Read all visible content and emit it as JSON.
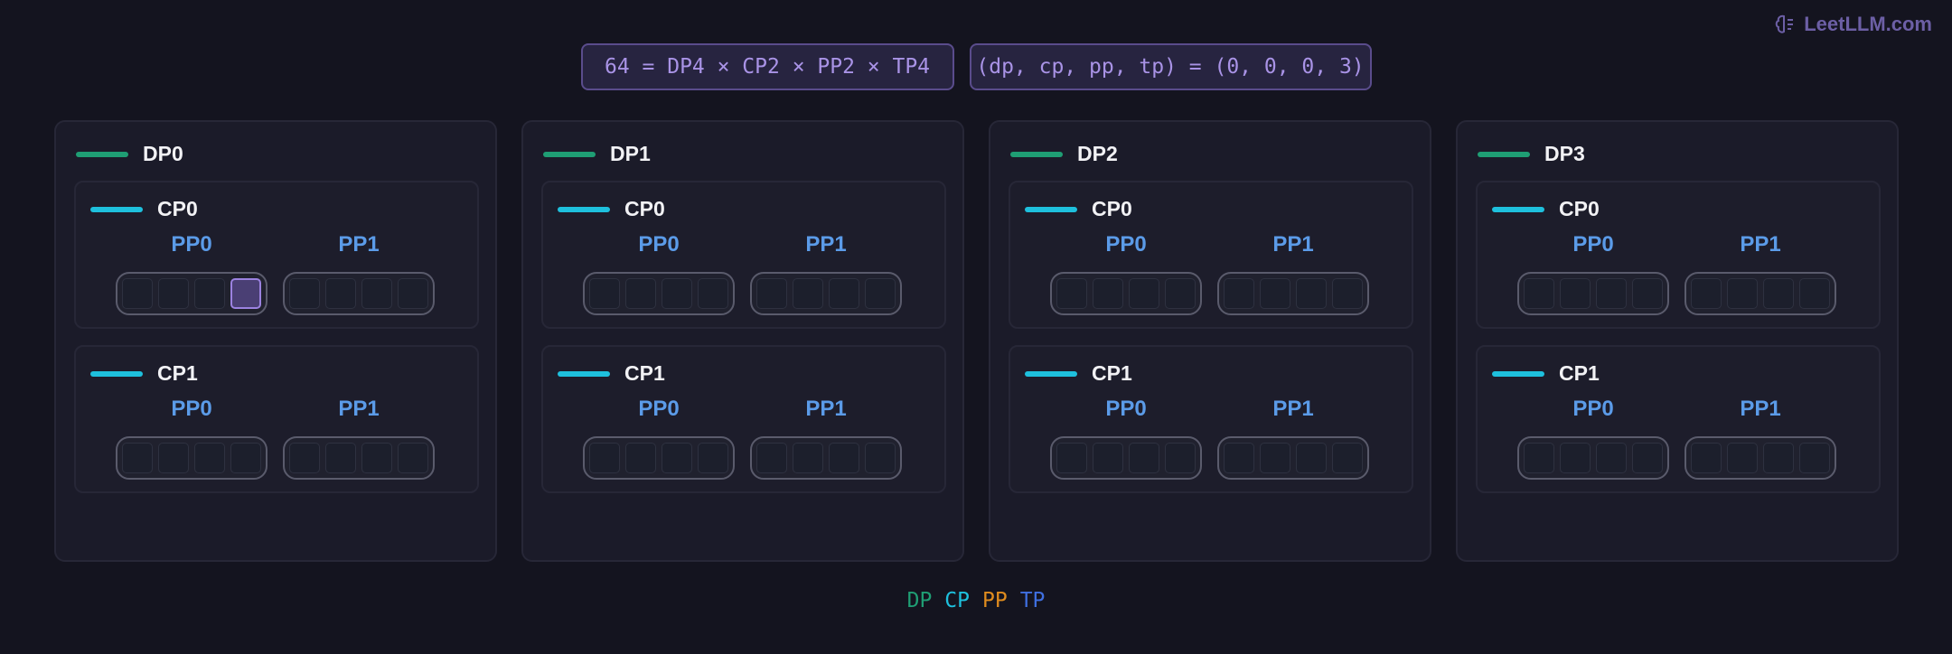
{
  "brand": {
    "name": "LeetLLM.com",
    "icon": "brain-icon",
    "color": "#6c5fa5"
  },
  "formula": "64 = DP4 × CP2 × PP2 × TP4",
  "coordinate": "(dp, cp, pp, tp) = (0, 0, 0, 3)",
  "highlight": {
    "dp": 0,
    "cp": 0,
    "pp": 0,
    "tp": 3
  },
  "tp_per_pp": 4,
  "dp_groups": [
    {
      "label": "DP0",
      "cps": [
        {
          "label": "CP1",
          "pps": [
            "PP0",
            "PP1"
          ]
        }
      ]
    }
  ],
  "legend": [
    {
      "label": "DP",
      "color": "#1f9e74"
    },
    {
      "label": "CP",
      "color": "#1ec0dd"
    },
    {
      "label": "PP",
      "color": "#e08c1e"
    },
    {
      "label": "TP",
      "color": "#3f6fe0"
    }
  ]
}
